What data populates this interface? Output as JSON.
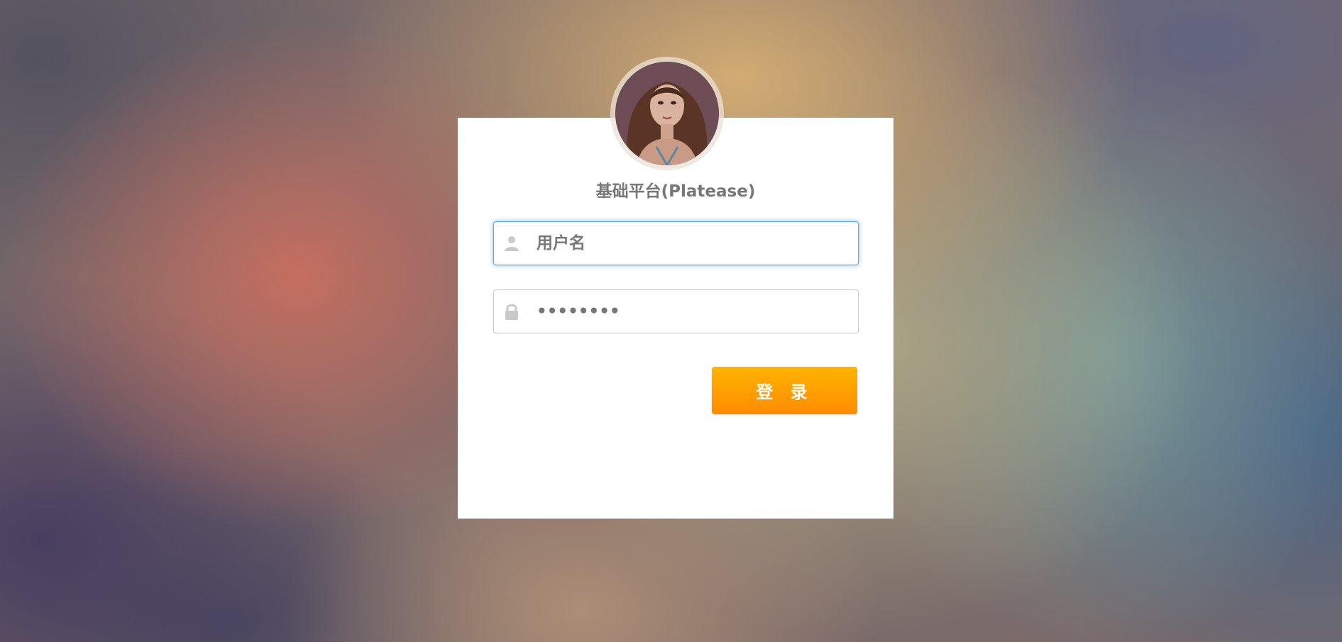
{
  "app": {
    "title": "基础平台(Platease)"
  },
  "login_form": {
    "username": {
      "placeholder": "用户名",
      "value": "",
      "icon": "user-icon"
    },
    "password": {
      "value": "••••••••",
      "icon": "lock-icon"
    },
    "submit_label": "登 录"
  },
  "colors": {
    "accent_top": "#ffb300",
    "accent_bottom": "#ff8c00",
    "focus_border": "#5aa8e0",
    "text": "#777777"
  }
}
